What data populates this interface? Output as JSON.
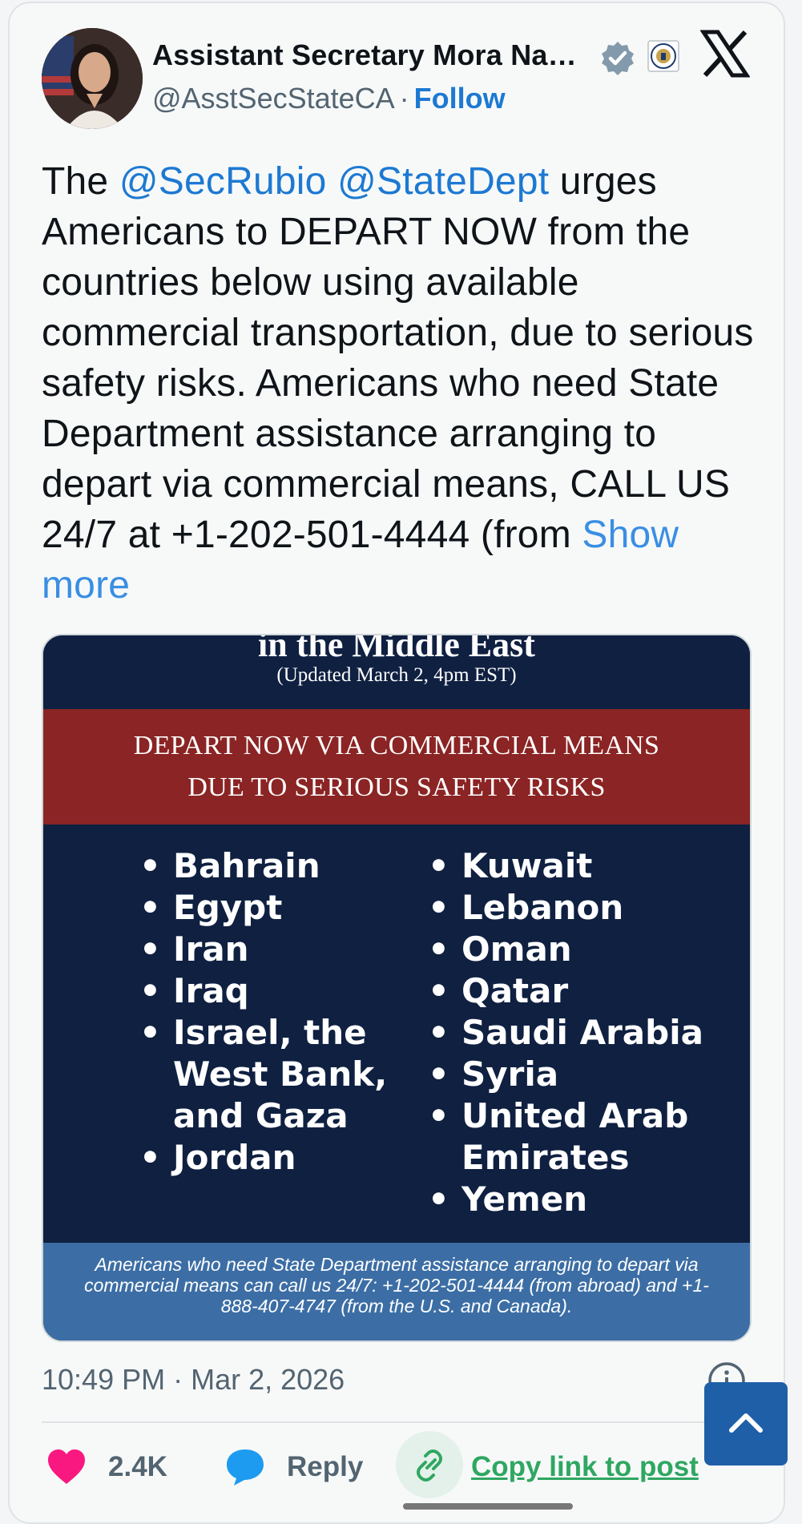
{
  "author": {
    "name": "Assistant Secretary Mora Na…",
    "handle": "@AsstSecStateCA",
    "separator": "·",
    "follow_label": "Follow"
  },
  "tweet": {
    "prefix": "The ",
    "mention1": "@SecRubio",
    "space": " ",
    "mention2": "@StateDept",
    "body": " urges Americans to DEPART NOW from the countries below using available commercial transportation, due to serious safety risks. Americans who need State Department assistance arranging to depart via commercial means, CALL US 24/7 at +1-202-501-4444 (from ",
    "show_more": "Show more"
  },
  "media": {
    "heading": "in the Middle East",
    "updated": "(Updated March 2, 4pm EST)",
    "banner_line1": "DEPART NOW VIA COMMERCIAL MEANS",
    "banner_line2": "DUE TO SERIOUS SAFETY RISKS",
    "left_countries": [
      "Bahrain",
      "Egypt",
      "Iran",
      "Iraq",
      "Israel, the West Bank, and Gaza",
      "Jordan"
    ],
    "right_countries": [
      "Kuwait",
      "Lebanon",
      "Oman",
      "Qatar",
      "Saudi Arabia",
      "Syria",
      "United Arab Emirates",
      "Yemen"
    ],
    "footer": "Americans who need State Department assistance arranging to depart via commercial means can call us 24/7: +1-202-501-4444 (from abroad) and +1-888-407-4747 (from the U.S. and Canada)."
  },
  "timestamp": "10:49 PM · Mar 2, 2026",
  "actions": {
    "like_count": "2.4K",
    "reply_label": "Reply",
    "copy_label": "Copy link to post"
  },
  "colors": {
    "link_blue": "#1d79d2",
    "banner_red": "#8b2424",
    "navy": "#0f2041",
    "footer_blue": "#3c6ea5",
    "like_pink": "#f91880",
    "copy_green": "#2fa761"
  },
  "icons": [
    "verified-badge-icon",
    "state-dept-seal-icon",
    "x-logo-icon",
    "info-icon",
    "heart-icon",
    "reply-bubble-icon",
    "link-icon",
    "chevron-up-icon"
  ]
}
